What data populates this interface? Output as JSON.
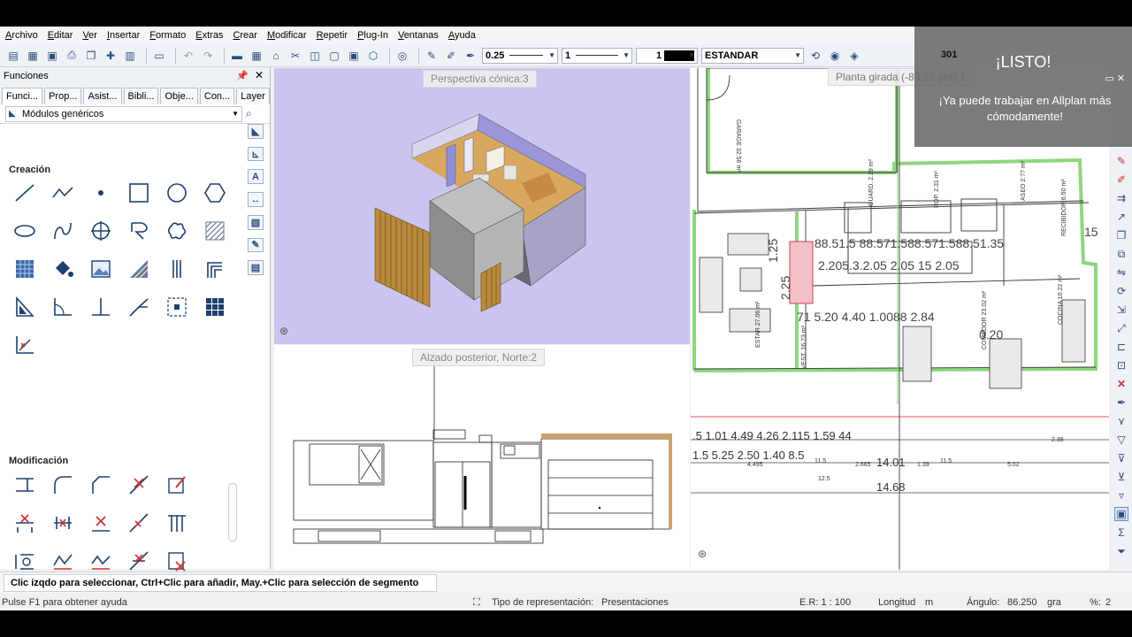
{
  "menu": [
    "Archivo",
    "Editar",
    "Ver",
    "Insertar",
    "Formato",
    "Extras",
    "Crear",
    "Modificar",
    "Repetir",
    "Plug-In",
    "Ventanas",
    "Ayuda"
  ],
  "toolbar": {
    "pen_thickness": "0.25",
    "line_type": "1",
    "color_number": "1",
    "layer": "ESTANDAR"
  },
  "notification": {
    "number": "301",
    "title": "¡LISTO!",
    "message": "¡Ya puede trabajar en Allplan más cómodamente!"
  },
  "panel": {
    "title": "Funciones",
    "tabs": [
      "Funci...",
      "Prop...",
      "Asist...",
      "Bibli...",
      "Obje...",
      "Con...",
      "Layer"
    ],
    "module": "Módulos genéricos",
    "section_create": "Creación",
    "section_modify": "Modificación",
    "side_tools": [
      "A",
      "↔"
    ]
  },
  "viewports": {
    "perspective_label": "Perspectiva cónica:3",
    "elevation_label": "Alzado posterior, Norte:2",
    "plan_label": "Planta girada (-86.25 gra):1"
  },
  "plan": {
    "rooms": [
      {
        "name": "GARAGE",
        "area": "32.56 m²"
      },
      {
        "name": "GUARD.",
        "area": "2.39 m²"
      },
      {
        "name": "ROP.",
        "area": "2.31 m²"
      },
      {
        "name": "ASEO",
        "area": "2.77 m²"
      },
      {
        "name": "RECIBIDOR",
        "area": "6.50 m²"
      },
      {
        "name": "ESTAR",
        "area": "27.06 m²"
      },
      {
        "name": "VEST.",
        "area": "16.73 m²"
      },
      {
        "name": "COMEDOR",
        "area": "23.02 m²"
      },
      {
        "name": "COCINA",
        "area": "10.22 m²"
      }
    ],
    "dimensions": {
      "row1": [
        "88.5",
        "1.5",
        "88.5",
        "71.5",
        "88.5",
        "71.5",
        "88.5",
        "1.35",
        "15"
      ],
      "row2": [
        "2.20",
        "5.3",
        "2.05",
        "2.05",
        "15",
        "2.05"
      ],
      "side": [
        "1.25",
        "2.25"
      ],
      "misc": [
        "71",
        "5.20",
        "4.40",
        "1.00",
        "88",
        "2.84",
        "0.20",
        "15"
      ],
      "bottom1": [
        "1.01",
        "4.49",
        "4.26",
        "2.115",
        "1.59",
        "44"
      ],
      "bottom2": [
        "1.5",
        "5.25",
        "2.50",
        "1.40",
        "8.5"
      ],
      "bottom_small": [
        "4.495",
        "11.5",
        "2.665",
        "1.39",
        "11.5",
        "5.02",
        "2.38",
        "12.5"
      ],
      "bottom3": "14.01",
      "total": "14.68"
    }
  },
  "prompt": "Clic izqdo para seleccionar, Ctrl+Clic para añadir, May.+Clic para selección de segmento",
  "status": {
    "help": "Pulse F1 para obtener ayuda",
    "repr_label": "Tipo de representación:",
    "repr_value": "Presentaciones",
    "scale": "E.R: 1 : 100",
    "length": "Longitud",
    "length_unit": "m",
    "angle_label": "Ángulo:",
    "angle_value": "86.250",
    "angle_unit": "gra",
    "percent_label": "%:",
    "percent_value": "2"
  },
  "colors": {
    "accent": "#2c4f7c",
    "perspective_bg": "#c9c5f0",
    "wall_green": "#8fd67e",
    "notification_bg": "#696969"
  }
}
